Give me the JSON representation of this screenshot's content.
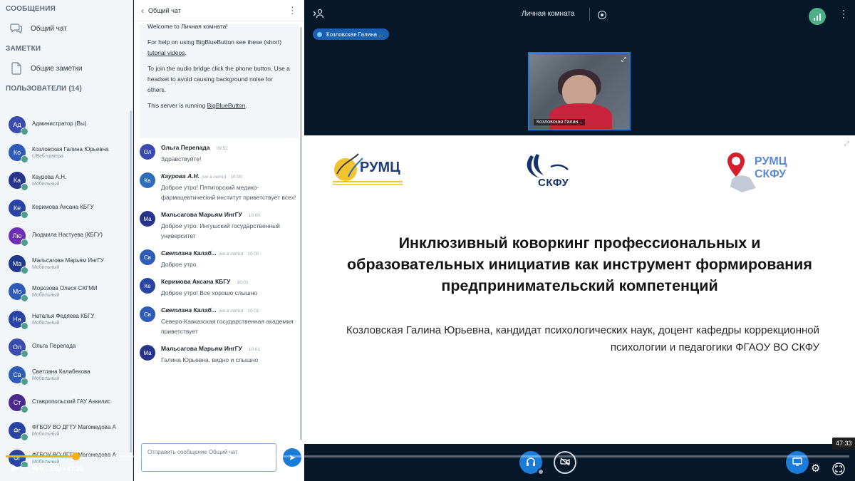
{
  "sidebar": {
    "messages_section": "СООБЩЕНИЯ",
    "public_chat": "Общий чат",
    "notes_section": "ЗАМЕТКИ",
    "shared_notes": "Общие заметки",
    "users_section": "ПОЛЬЗОВАТЕЛИ (14)",
    "users": [
      {
        "initials": "Ад",
        "name": "Администратор  (Вы)",
        "sub": "",
        "color": "#3a4bb0"
      },
      {
        "initials": "Ко",
        "name": "Козловская Галина Юрьевна",
        "sub": "c/Веб-камера",
        "color": "#2e5bb8"
      },
      {
        "initials": "Ка",
        "name": "Каурова А.Н.",
        "sub": "Мобильный",
        "color": "#27348b"
      },
      {
        "initials": "Ке",
        "name": "Керимова Аксана КБГУ",
        "sub": "",
        "color": "#2a44a5"
      },
      {
        "initials": "Лю",
        "name": "Людмила Настуева (КБГУ)",
        "sub": "",
        "color": "#6c2fb3"
      },
      {
        "initials": "Ма",
        "name": "Мальсагова Марьям ИнгГУ",
        "sub": "Мобильный",
        "color": "#1f3a8c"
      },
      {
        "initials": "Мо",
        "name": "Морозова Олеся СКГМИ",
        "sub": "Мобильный",
        "color": "#2e5bb8"
      },
      {
        "initials": "На",
        "name": "Наталья Федяева КБГУ",
        "sub": "Мобильный",
        "color": "#2a44a5"
      },
      {
        "initials": "Ол",
        "name": "Ольга Перепада",
        "sub": "",
        "color": "#3a4bb0"
      },
      {
        "initials": "Св",
        "name": "Светлана Калабекова",
        "sub": "Мобильный",
        "color": "#2e5bb8"
      },
      {
        "initials": "Ст",
        "name": "Ставропольский ГАУ Анкилис",
        "sub": "",
        "color": "#4a2a8c"
      },
      {
        "initials": "Фг",
        "name": "ФГБОУ ВО ДГТУ Магомедова А",
        "sub": "Мобильный",
        "color": "#2a44a5"
      },
      {
        "initials": "Фг",
        "name": "ФГБОУ ВО ДГТУ Магомедова А",
        "sub": "Мобильный",
        "color": "#2a44a5"
      }
    ]
  },
  "chat": {
    "title": "Общий чат",
    "welcome": {
      "line0": "Welcome to Личная комната!",
      "p1a": "For help on using BigBlueButton see these (short) ",
      "p1link": "tutorial videos",
      "p1b": ".",
      "p2": "To join the audio bridge click the phone button. Use a headset to avoid causing background noise for others.",
      "p3a": "This server is running ",
      "p3link": "BigBlueButton",
      "p3b": "."
    },
    "messages": [
      {
        "initials": "Ол",
        "color": "#3a4bb0",
        "name": "Ольга Перепада",
        "offline": "",
        "time": "09:52",
        "text": "Здравствуйте!",
        "italic": false
      },
      {
        "initials": "Ка",
        "color": "#2e6db8",
        "name": "Каурова А.Н.",
        "offline": "(не в сети)",
        "time": "10:00",
        "text": "Доброе утро! Пятигорский медико-фармацевтический институт приветствует всех!",
        "italic": true
      },
      {
        "initials": "Ма",
        "color": "#27348b",
        "name": "Мальсагова Марьям ИнгГУ",
        "offline": "",
        "time": "10:00",
        "text": "Доброе утро. Ингушский государственный университет",
        "italic": false
      },
      {
        "initials": "Св",
        "color": "#2e5bb8",
        "name": "Светлана Калаб...",
        "offline": "(не в сети)",
        "time": "10:00",
        "text": "Доброе утро",
        "italic": true
      },
      {
        "initials": "Ке",
        "color": "#2a44a5",
        "name": "Керимова Аксана КБГУ",
        "offline": "",
        "time": "10:01",
        "text": "Доброе утро! Все хорошо слышно",
        "italic": false
      },
      {
        "initials": "Св",
        "color": "#2e5bb8",
        "name": "Светлана Калаб...",
        "offline": "(не в сети)",
        "time": "10:01",
        "text": "Северо-Кавказская государственная академия приветствует",
        "italic": true
      },
      {
        "initials": "Ма",
        "color": "#27348b",
        "name": "Мальсагова Марьям ИнгГУ",
        "offline": "",
        "time": "10:01",
        "text": "Галина Юрьевна, видно и слышно",
        "italic": false
      }
    ],
    "input_placeholder": "Отправить сообщение Общий чат"
  },
  "topbar": {
    "room_name": "Личная комната"
  },
  "talking_indicator": "Козловская Галина ...",
  "webcam": {
    "name": "Козловская Галин..."
  },
  "slide": {
    "logo1_text": "РУМЦ",
    "logo2_text": "СКФУ",
    "logo3_text_a": "РУМЦ",
    "logo3_text_b": "СКФУ",
    "title": "Инклюзивный коворкинг профессиональных и образовательных инициатив как инструмент формирования предпринимательский компетенций",
    "subtitle": "Козловская Галина Юрьевна, кандидат психологических наук, доцент кафедры коррекционной психологии и педагогики ФГАОУ ВО СКФУ"
  },
  "player": {
    "current_time": "3:53",
    "duration": "47:33",
    "time_display": "3:53 / 47:33",
    "hover_time": "47:33",
    "progress_fraction": 0.083
  },
  "colors": {
    "accent": "#1b7bd8",
    "progress": "#f4b400",
    "online_badge": "#4f9d8c",
    "connection": "#4caf86"
  }
}
